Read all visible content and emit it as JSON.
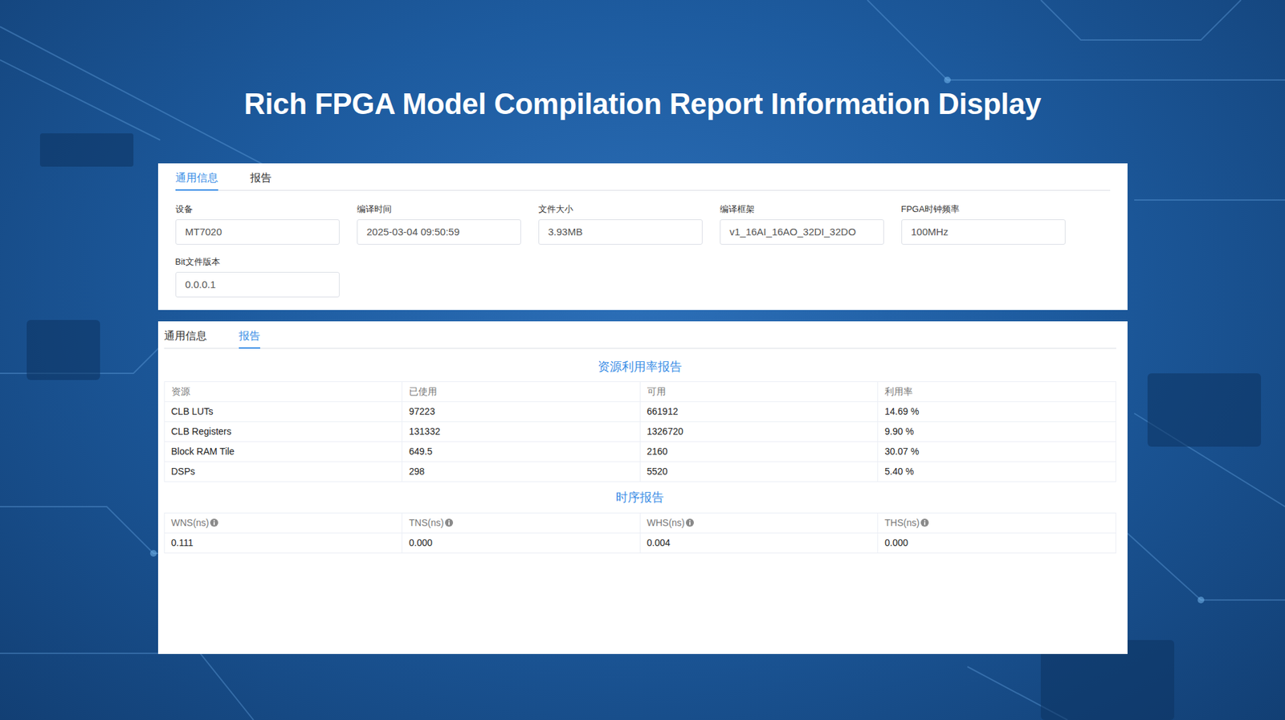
{
  "title": "Rich FPGA Model Compilation Report Information Display",
  "general_panel": {
    "tabs": [
      {
        "label": "通用信息",
        "selected": true
      },
      {
        "label": "报告",
        "selected": false
      }
    ],
    "fields": [
      {
        "label": "设备",
        "value": "MT7020"
      },
      {
        "label": "编译时间",
        "value": "2025-03-04 09:50:59"
      },
      {
        "label": "文件大小",
        "value": "3.93MB"
      },
      {
        "label": "编译框架",
        "value": "v1_16AI_16AO_32DI_32DO"
      },
      {
        "label": "FPGA时钟频率",
        "value": "100MHz"
      },
      {
        "label": "Bit文件版本",
        "value": "0.0.0.1"
      }
    ]
  },
  "report_panel": {
    "tabs": [
      {
        "label": "通用信息",
        "selected": false
      },
      {
        "label": "报告",
        "selected": true
      }
    ],
    "resource_report": {
      "title": "资源利用率报告",
      "columns": [
        "资源",
        "已使用",
        "可用",
        "利用率"
      ],
      "rows": [
        [
          "CLB LUTs",
          "97223",
          "661912",
          "14.69 %"
        ],
        [
          "CLB Registers",
          "131332",
          "1326720",
          "9.90 %"
        ],
        [
          "Block RAM Tile",
          "649.5",
          "2160",
          "30.07 %"
        ],
        [
          "DSPs",
          "298",
          "5520",
          "5.40 %"
        ]
      ]
    },
    "timing_report": {
      "title": "时序报告",
      "columns": [
        "WNS(ns)",
        "TNS(ns)",
        "WHS(ns)",
        "THS(ns)"
      ],
      "values": [
        "0.111",
        "0.000",
        "0.004",
        "0.000"
      ]
    }
  }
}
